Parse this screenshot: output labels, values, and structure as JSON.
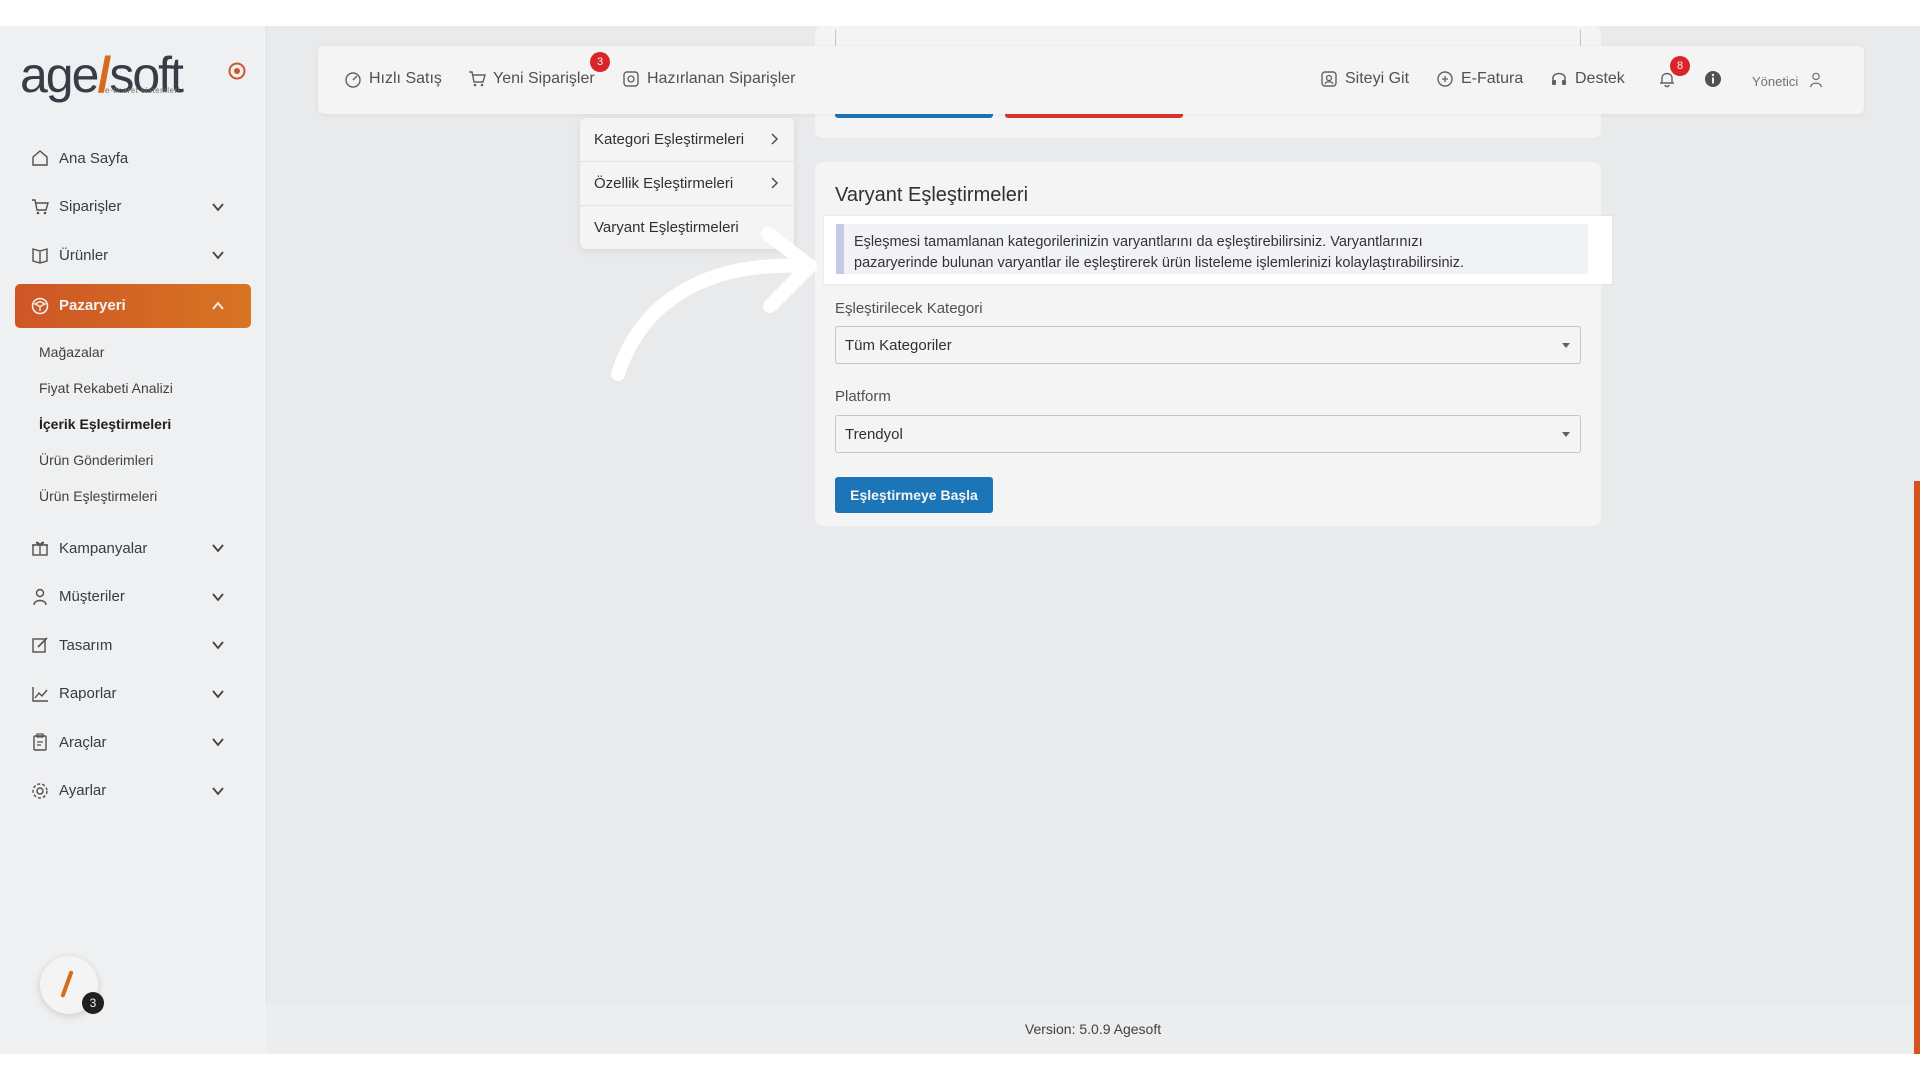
{
  "brand": {
    "logo_left": "age",
    "logo_right": "soft",
    "logo_sub": "e-ticaret sistemleri"
  },
  "sidebar": {
    "items": [
      {
        "label": "Ana Sayfa",
        "icon": "home-icon"
      },
      {
        "label": "Siparişler",
        "icon": "cart-icon"
      },
      {
        "label": "Ürünler",
        "icon": "book-icon"
      },
      {
        "label": "Pazaryeri",
        "icon": "cube-icon"
      },
      {
        "label": "Kampanyalar",
        "icon": "gift-icon"
      },
      {
        "label": "Müşteriler",
        "icon": "user-icon"
      },
      {
        "label": "Tasarım",
        "icon": "edit-icon"
      },
      {
        "label": "Raporlar",
        "icon": "chart-icon"
      },
      {
        "label": "Araçlar",
        "icon": "clipboard-icon"
      },
      {
        "label": "Ayarlar",
        "icon": "gear-icon"
      }
    ],
    "pazaryeri_sub": [
      "Mağazalar",
      "Fiyat Rekabeti Analizi",
      "İçerik Eşleştirmeleri",
      "Ürün Gönderimleri",
      "Ürün Eşleştirmeleri"
    ],
    "help_badge": "3"
  },
  "topbar": {
    "quick_sale": "Hızlı Satış",
    "new_orders": "Yeni Siparişler",
    "new_orders_badge": "3",
    "preparing_orders": "Hazırlanan Siparişler",
    "go_site": "Siteyi Git",
    "e_invoice": "E-Fatura",
    "support": "Destek",
    "notifications_badge": "8",
    "user": "Yönetici"
  },
  "submenu": {
    "items": [
      "Kategori Eşleştirmeleri",
      "Özellik Eşleştirmeleri",
      "Varyant Eşleştirmeleri"
    ]
  },
  "main": {
    "title": "Varyant Eşleştirmeleri",
    "alert_line1": "Eşleşmesi tamamlanan kategorilerinizin varyantlarını da eşleştirebilirsiniz. Varyantlarınızı",
    "alert_line2": "pazaryerinde bulunan varyantlar ile eşleştirerek ürün listeleme işlemlerinizi kolaylaştırabilirsiniz.",
    "category_label": "Eşleştirilecek Kategori",
    "category_value": "Tüm Kategoriler",
    "platform_label": "Platform",
    "platform_value": "Trendyol",
    "start_button": "Eşleştirmeye Başla"
  },
  "footer": {
    "version": "Version: 5.0.9 Agesoft"
  },
  "colors": {
    "accent": "#e0701c",
    "primary": "#1d7bbf",
    "danger": "#e3262c"
  }
}
